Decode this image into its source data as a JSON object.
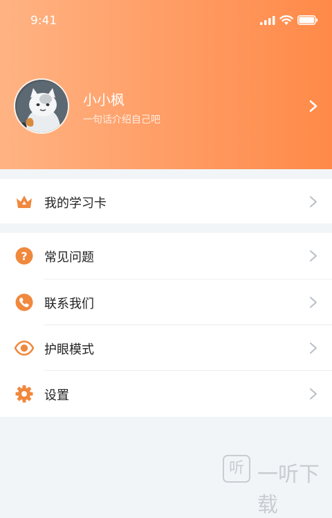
{
  "status_bar": {
    "time": "9:41"
  },
  "profile": {
    "name": "小小枫",
    "bio": "一句话介绍自己吧"
  },
  "menu": {
    "study_card": {
      "label": "我的学习卡",
      "icon": "crown-icon"
    },
    "items": [
      {
        "label": "常见问题",
        "icon": "question-icon"
      },
      {
        "label": "联系我们",
        "icon": "phone-icon"
      },
      {
        "label": "护眼模式",
        "icon": "eye-icon"
      },
      {
        "label": "设置",
        "icon": "gear-icon"
      }
    ]
  },
  "watermark": {
    "glyph": "听",
    "text": "一听下载"
  },
  "colors": {
    "accent": "#ff8a48",
    "accent_light": "#ffb383",
    "icon_orange": "#f0883d",
    "chevron": "#b9bec6",
    "background": "#f2f5f8"
  }
}
